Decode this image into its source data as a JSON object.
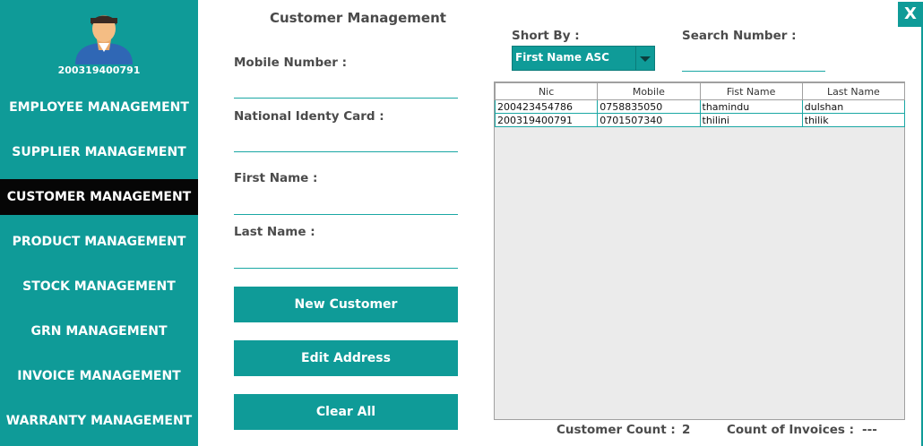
{
  "sidebar": {
    "user_id": "200319400791",
    "items": [
      {
        "label": "EMPLOYEE MANAGEMENT"
      },
      {
        "label": "SUPPLIER MANAGEMENT"
      },
      {
        "label": "CUSTOMER MANAGEMENT",
        "active": true
      },
      {
        "label": "PRODUCT MANAGEMENT"
      },
      {
        "label": "STOCK MANAGEMENT"
      },
      {
        "label": "GRN MANAGEMENT"
      },
      {
        "label": "INVOICE MANAGEMENT"
      },
      {
        "label": "WARRANTY MANAGEMENT"
      }
    ]
  },
  "form": {
    "title": "Customer Management",
    "mobile_label": "Mobile Number :",
    "mobile_value": "",
    "nic_label": "National Identy Card :",
    "nic_value": "",
    "first_name_label": "First Name :",
    "first_name_value": "",
    "last_name_label": "Last Name :",
    "last_name_value": "",
    "new_customer_label": "New Customer",
    "edit_address_label": "Edit Address",
    "clear_all_label": "Clear All"
  },
  "sort": {
    "label": "Short By  :",
    "selected": "First Name ASC"
  },
  "search": {
    "label": "Search Number :",
    "value": ""
  },
  "table": {
    "columns": [
      "Nic",
      "Mobile",
      "Fist Name",
      "Last Name"
    ],
    "rows": [
      [
        "200423454786",
        "0758835050",
        "thamindu",
        "dulshan"
      ],
      [
        "200319400791",
        "0701507340",
        "thilini",
        "thilik"
      ]
    ]
  },
  "footer": {
    "customer_count_label": "Customer Count  :",
    "customer_count_value": "2",
    "invoice_count_label": "Count of Invoices :",
    "invoice_count_value": "---"
  },
  "window": {
    "close_label": "X"
  },
  "colors": {
    "accent": "#0f9b98",
    "active_nav": "#060606",
    "text": "#4b4b4b"
  }
}
